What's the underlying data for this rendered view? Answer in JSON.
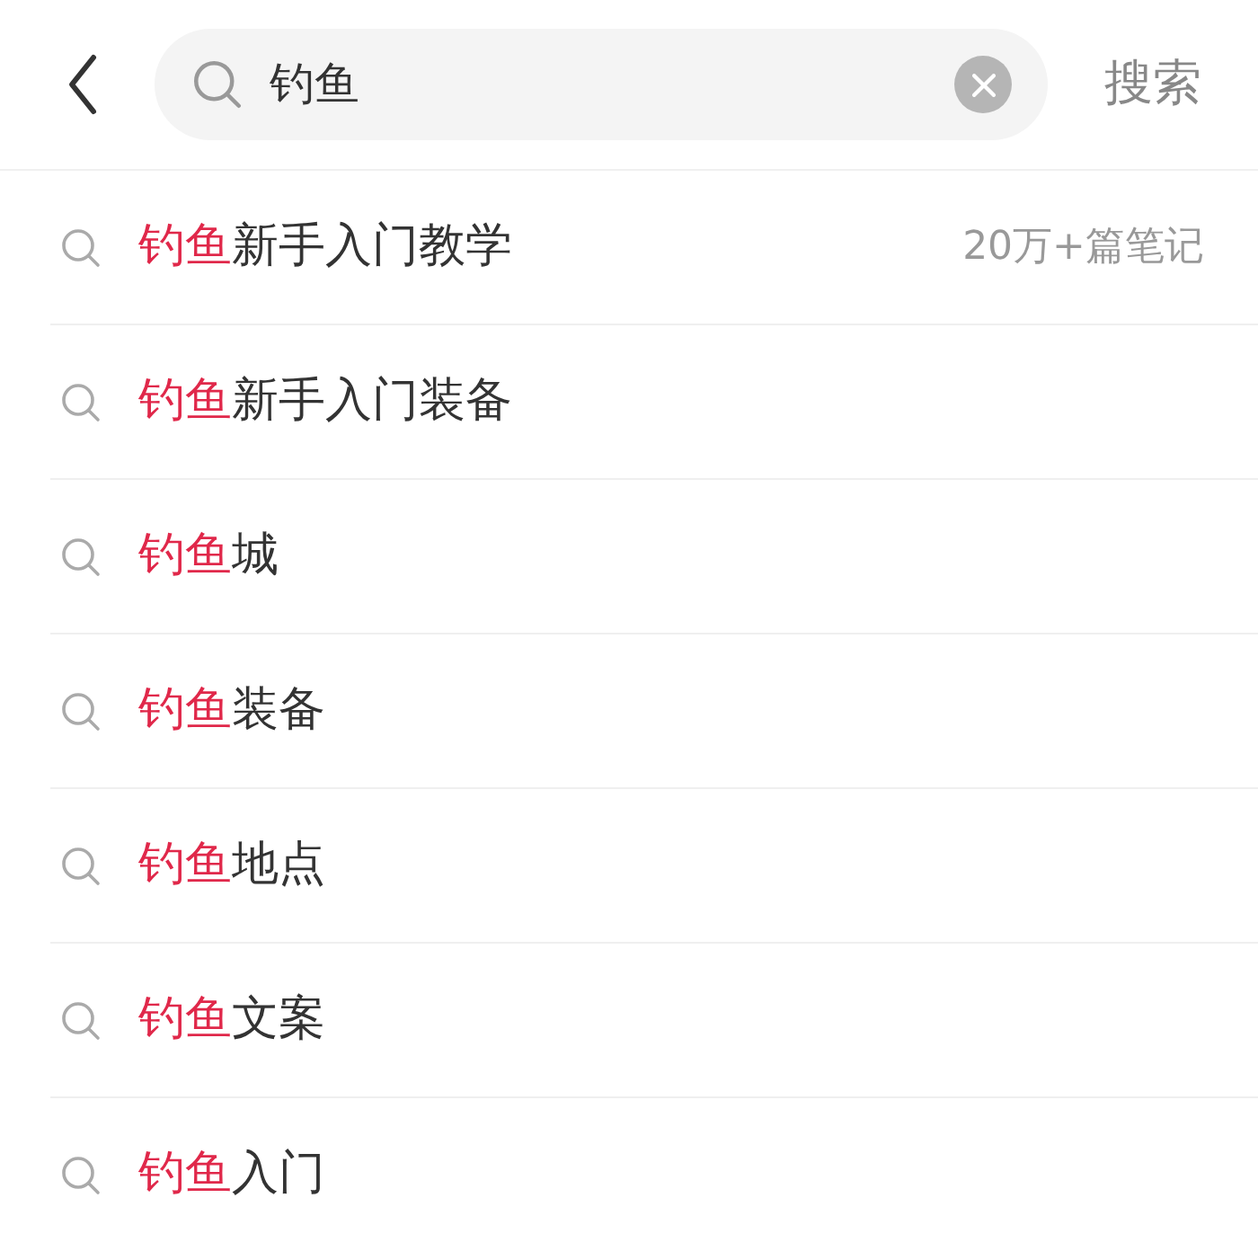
{
  "search": {
    "value": "钓鱼",
    "submit": "搜索"
  },
  "suggestions": [
    {
      "match": "钓鱼",
      "rest": "新手入门教学",
      "count": "20万+篇笔记"
    },
    {
      "match": "钓鱼",
      "rest": "新手入门装备"
    },
    {
      "match": "钓鱼",
      "rest": "城"
    },
    {
      "match": "钓鱼",
      "rest": "装备"
    },
    {
      "match": "钓鱼",
      "rest": "地点"
    },
    {
      "match": "钓鱼",
      "rest": "文案"
    },
    {
      "match": "钓鱼",
      "rest": "入门"
    }
  ]
}
